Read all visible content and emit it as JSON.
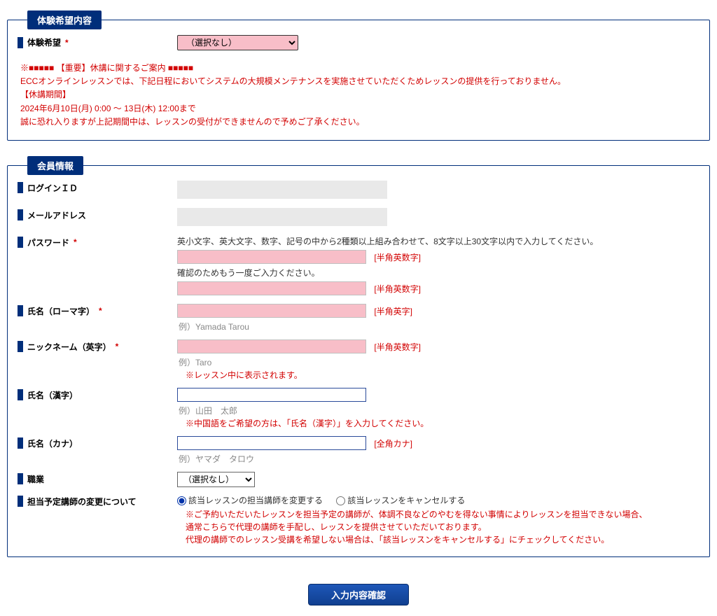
{
  "section1": {
    "title": "体験希望内容",
    "trial": {
      "label": "体験希望",
      "req": "*",
      "select_placeholder": "（選択なし）"
    },
    "notice": {
      "l1": "※■■■■■ 【重要】休講に関するご案内 ■■■■■",
      "l2": "ECCオンラインレッスンでは、下記日程においてシステムの大規模メンテナンスを実施させていただくためレッスンの提供を行っておりません。",
      "l3": "【休講期間】",
      "l4": "2024年6月10日(月) 0:00 ～ 13日(木) 12:00まで",
      "l5": "誠に恐れ入りますが上記期間中は、レッスンの受付ができませんので予めご了承ください。"
    }
  },
  "section2": {
    "title": "会員情報",
    "login": {
      "label": "ログインＩＤ",
      "value": ""
    },
    "email": {
      "label": "メールアドレス",
      "value": ""
    },
    "password": {
      "label": "パスワード",
      "req": "*",
      "rule": "英小文字、英大文字、数字、記号の中から2種類以上組み合わせて、8文字以上30文字以内で入力してください。",
      "hint1": "[半角英数字]",
      "confirm": "確認のためもう一度ご入力ください。",
      "hint2": "[半角英数字]"
    },
    "roman": {
      "label": "氏名（ローマ字）",
      "req": "*",
      "hint": "[半角英字]",
      "ex": "例）Yamada Tarou"
    },
    "nick": {
      "label": "ニックネーム（英字）",
      "req": "*",
      "hint": "[半角英数字]",
      "ex": "例）Taro",
      "note": "※レッスン中に表示されます。"
    },
    "kanji": {
      "label": "氏名（漢字）",
      "ex": "例）山田　太郎",
      "note": "※中国語をご希望の方は、「氏名（漢字）」を入力してください。"
    },
    "kana": {
      "label": "氏名（カナ）",
      "hint": "[全角カナ]",
      "ex": "例）ヤマダ　タロウ"
    },
    "job": {
      "label": "職業",
      "select_placeholder": "（選択なし）"
    },
    "change": {
      "label": "担当予定講師の変更について",
      "opt1": "該当レッスンの担当講師を変更する",
      "opt2": "該当レッスンをキャンセルする",
      "note1": "※ご予約いただいたレッスンを担当予定の講師が、体調不良などのやむを得ない事情によりレッスンを担当できない場合、",
      "note2": "通常こちらで代理の講師を手配し、レッスンを提供させていただいております。",
      "note3": "代理の講師でのレッスン受講を希望しない場合は、「該当レッスンをキャンセルする」にチェックしてください。"
    }
  },
  "submit": {
    "label": "入力内容確認"
  }
}
